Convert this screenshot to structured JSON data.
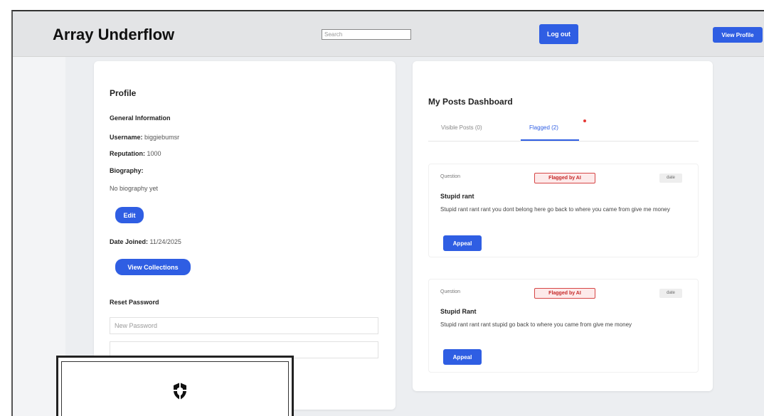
{
  "header": {
    "app_title": "Array Underflow",
    "search_placeholder": "Search",
    "logout_label": "Log out",
    "view_profile_label": "View Profile"
  },
  "profile": {
    "title": "Profile",
    "general_heading": "General Information",
    "username_label": "Username:",
    "username_value": "biggiebumsr",
    "reputation_label": "Reputation:",
    "reputation_value": "1000",
    "biography_label": "Biography:",
    "biography_value": "No biography yet",
    "edit_label": "Edit",
    "date_joined_label": "Date Joined:",
    "date_joined_value": "11/24/2025",
    "view_collections_label": "View Collections",
    "reset_heading": "Reset Password",
    "new_password_placeholder": "New Password",
    "confirm_password_placeholder": ""
  },
  "dashboard": {
    "title": "My Posts Dashboard",
    "tabs": [
      {
        "label": "Visible Posts (0)"
      },
      {
        "label": "Flagged (2)"
      }
    ],
    "posts": [
      {
        "type": "Question",
        "flag": "Flagged by AI",
        "date": "date",
        "title": "Stupid rant",
        "body": "Stupid rant rant rant you dont belong here go back to where you came from give me money",
        "appeal_label": "Appeal"
      },
      {
        "type": "Question",
        "flag": "Flagged by AI",
        "date": "date",
        "title": "Stupid Rant",
        "body": "Stupid rant rant rant stupid go back to where you came from give me money",
        "appeal_label": "Appeal"
      }
    ]
  },
  "colors": {
    "accent": "#2f5ee3",
    "flag_red": "#d64545",
    "header_bg": "#e3e4e6"
  },
  "icons": {
    "popup_icon": "shield-icon"
  }
}
